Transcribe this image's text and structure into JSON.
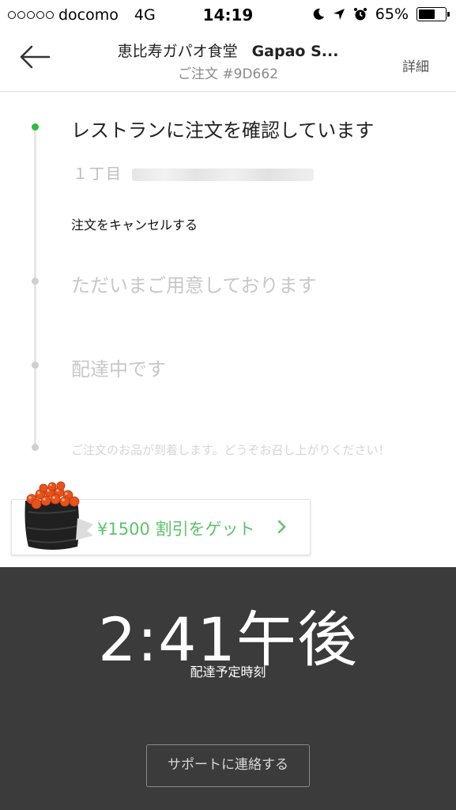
{
  "status_bar": {
    "carrier": "docomo",
    "network": "4G",
    "time": "14:19",
    "battery": "65%",
    "battery_level": 0.65
  },
  "header": {
    "restaurant_jp": "恵比寿ガパオ食堂",
    "restaurant_en": "Gapao S...",
    "order_number": "ご注文 #9D662",
    "detail_label": "詳細"
  },
  "timeline": {
    "step1": "レストランに注文を確認しています",
    "address_visible": "１丁目",
    "cancel_label": "注文をキャンセルする",
    "step2": "ただいまご用意しております",
    "step3": "配達中です",
    "step4_note": "ご注文のお品が到着します。どうぞお召し上がりください！"
  },
  "promo": {
    "text": "¥1500 割引をゲット"
  },
  "eta": {
    "time": "2:41午後",
    "label": "配達予定時刻",
    "support_button": "サポートに連絡する"
  },
  "colors": {
    "accent_green": "#2ebd3b",
    "promo_green": "#5cc26a",
    "panel_dark": "#3b3b3b"
  }
}
